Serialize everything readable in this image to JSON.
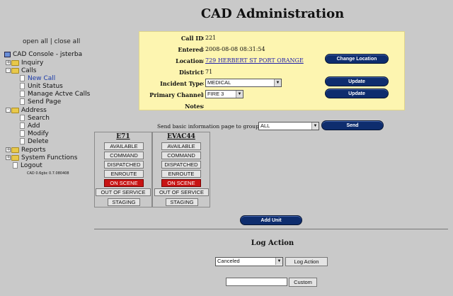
{
  "title": "CAD Administration",
  "sidebar": {
    "open_all": "open all",
    "sep": "|",
    "close_all": "close all",
    "root": "CAD Console - jsterba",
    "items": [
      {
        "label": "Inquiry"
      },
      {
        "label": "Calls"
      },
      {
        "label": "New Call"
      },
      {
        "label": "Unit Status"
      },
      {
        "label": "Manage Actve Calls"
      },
      {
        "label": "Send Page"
      },
      {
        "label": "Address"
      },
      {
        "label": "Search"
      },
      {
        "label": "Add"
      },
      {
        "label": "Modify"
      },
      {
        "label": "Delete"
      },
      {
        "label": "Reports"
      },
      {
        "label": "System Functions"
      },
      {
        "label": "Logout"
      }
    ],
    "version": "CAD 0.6gbc 0.7.080408"
  },
  "call": {
    "id_label": "Call ID",
    "id_value": "221",
    "entered_label": "Entered",
    "entered_value": "2008-08-08 08:31:54",
    "location_label": "Location",
    "location_value": "729 HERBERT ST PORT ORANGE",
    "district_label": "District",
    "district_value": "71",
    "incident_type_label": "Incident Type",
    "incident_type_value": "MEDICAL",
    "primary_channel_label": "Primary Channel",
    "primary_channel_value": "FIRE 3",
    "notes_label": "Notes",
    "colon": ":"
  },
  "buttons": {
    "change_location": "Change Location",
    "update1": "Update",
    "update2": "Update",
    "send": "Send",
    "add_unit": "Add Unit",
    "log_action": "Log Action",
    "custom": "Custom"
  },
  "send_page": {
    "label": "Send basic information page to group :",
    "group_value": "ALL"
  },
  "units": [
    {
      "name": "E71",
      "statuses": [
        "AVAILABLE",
        "COMMAND",
        "DISPATCHED",
        "ENROUTE",
        "ON SCENE",
        "OUT OF SERVICE",
        "STAGING"
      ],
      "active": "ON SCENE"
    },
    {
      "name": "EVAC44",
      "statuses": [
        "AVAILABLE",
        "COMMAND",
        "DISPATCHED",
        "ENROUTE",
        "ON SCENE",
        "OUT OF SERVICE",
        "STAGING"
      ],
      "active": "ON SCENE"
    }
  ],
  "log": {
    "title": "Log Action",
    "action_value": "Canceled",
    "custom_value": ""
  },
  "colors": {
    "background": "#c9c9c9",
    "panel": "#fdf5b0",
    "pill_button": "#0e2d6e",
    "active_status": "#c81414"
  }
}
